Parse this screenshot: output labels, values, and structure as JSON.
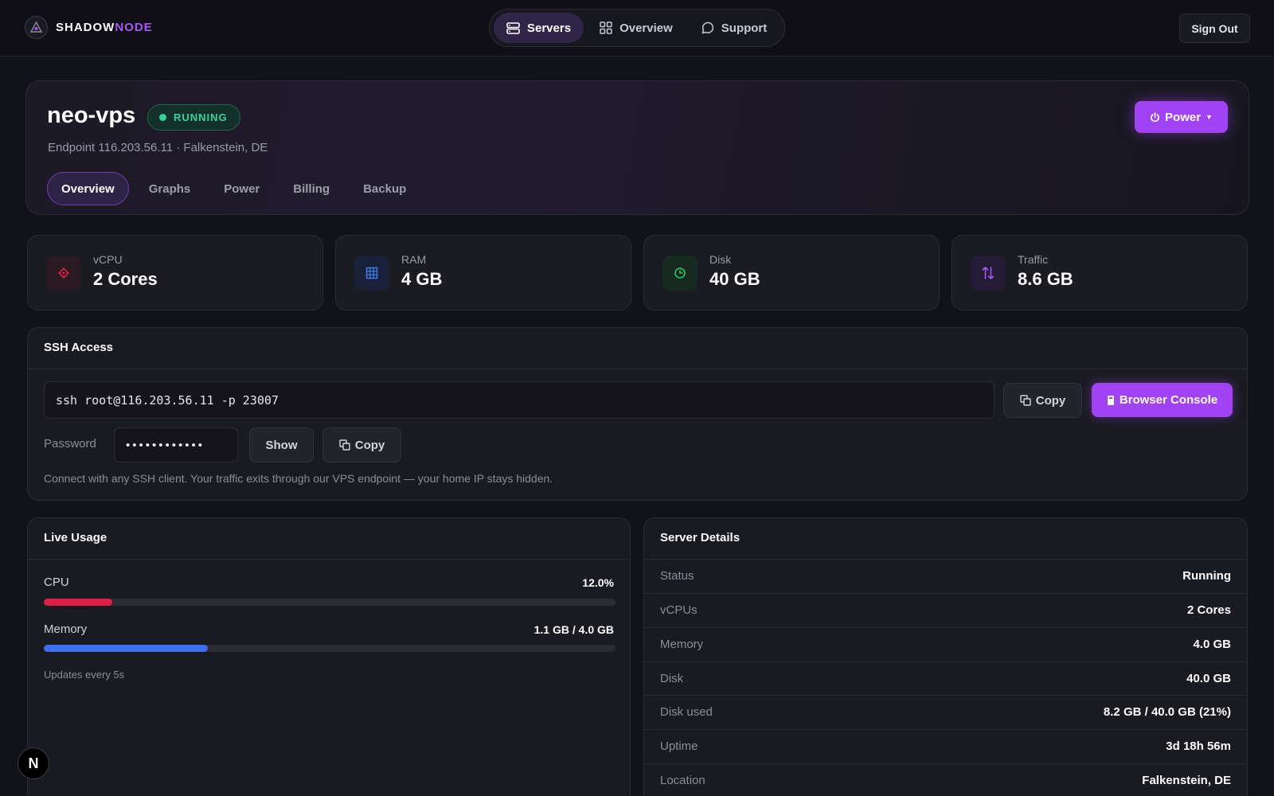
{
  "brand": {
    "part1": "SHADOW",
    "part2": "NODE"
  },
  "nav": {
    "items": [
      {
        "label": "Servers",
        "icon": "server-icon",
        "active": true
      },
      {
        "label": "Overview",
        "icon": "grid-icon",
        "active": false
      },
      {
        "label": "Support",
        "icon": "chat-icon",
        "active": false
      }
    ],
    "sign_out": "Sign Out"
  },
  "server": {
    "name": "neo-vps",
    "status": "RUNNING",
    "endpoint": "Endpoint 116.203.56.11 · Falkenstein, DE",
    "power_label": "Power",
    "tabs": [
      "Overview",
      "Graphs",
      "Power",
      "Billing",
      "Backup"
    ],
    "active_tab": "Overview"
  },
  "stats": [
    {
      "label": "vCPU",
      "value": "2 Cores",
      "icon": "cpu-icon",
      "color": "#e11d48"
    },
    {
      "label": "RAM",
      "value": "4 GB",
      "icon": "memory-icon",
      "color": "#3b82f6"
    },
    {
      "label": "Disk",
      "value": "40 GB",
      "icon": "disk-icon",
      "color": "#22c55e"
    },
    {
      "label": "Traffic",
      "value": "8.6 GB",
      "icon": "transfer-icon",
      "color": "#a855f7"
    }
  ],
  "ssh": {
    "title": "SSH Access",
    "command": "ssh root@116.203.56.11 -p 23007",
    "copy_label": "Copy",
    "console_label": "Browser Console",
    "password_label": "Password",
    "password_masked": "••••••••••••",
    "show_label": "Show",
    "copy_pw_label": "Copy",
    "hint": "Connect with any SSH client. Your traffic exits through our VPS endpoint — your home IP stays hidden."
  },
  "usage": {
    "title": "Live Usage",
    "cpu_label": "CPU",
    "cpu_value": "12.0%",
    "cpu_fraction": 0.12,
    "memory_label": "Memory",
    "memory_value": "1.1 GB / 4.0 GB",
    "memory_fraction": 0.2875,
    "updates": "Updates every 5s",
    "cpu_color": "#e11d48",
    "memory_color": "#3b6ef2"
  },
  "details": {
    "title": "Server Details",
    "rows": [
      {
        "key": "Status",
        "value": "Running"
      },
      {
        "key": "vCPUs",
        "value": "2 Cores"
      },
      {
        "key": "Memory",
        "value": "4.0 GB"
      },
      {
        "key": "Disk",
        "value": "40.0 GB"
      },
      {
        "key": "Disk used",
        "value": "8.2 GB / 40.0 GB (21%)"
      },
      {
        "key": "Uptime",
        "value": "3d 18h 56m"
      },
      {
        "key": "Location",
        "value": "Falkenstein, DE"
      }
    ]
  },
  "badge": {
    "letter": "N"
  }
}
